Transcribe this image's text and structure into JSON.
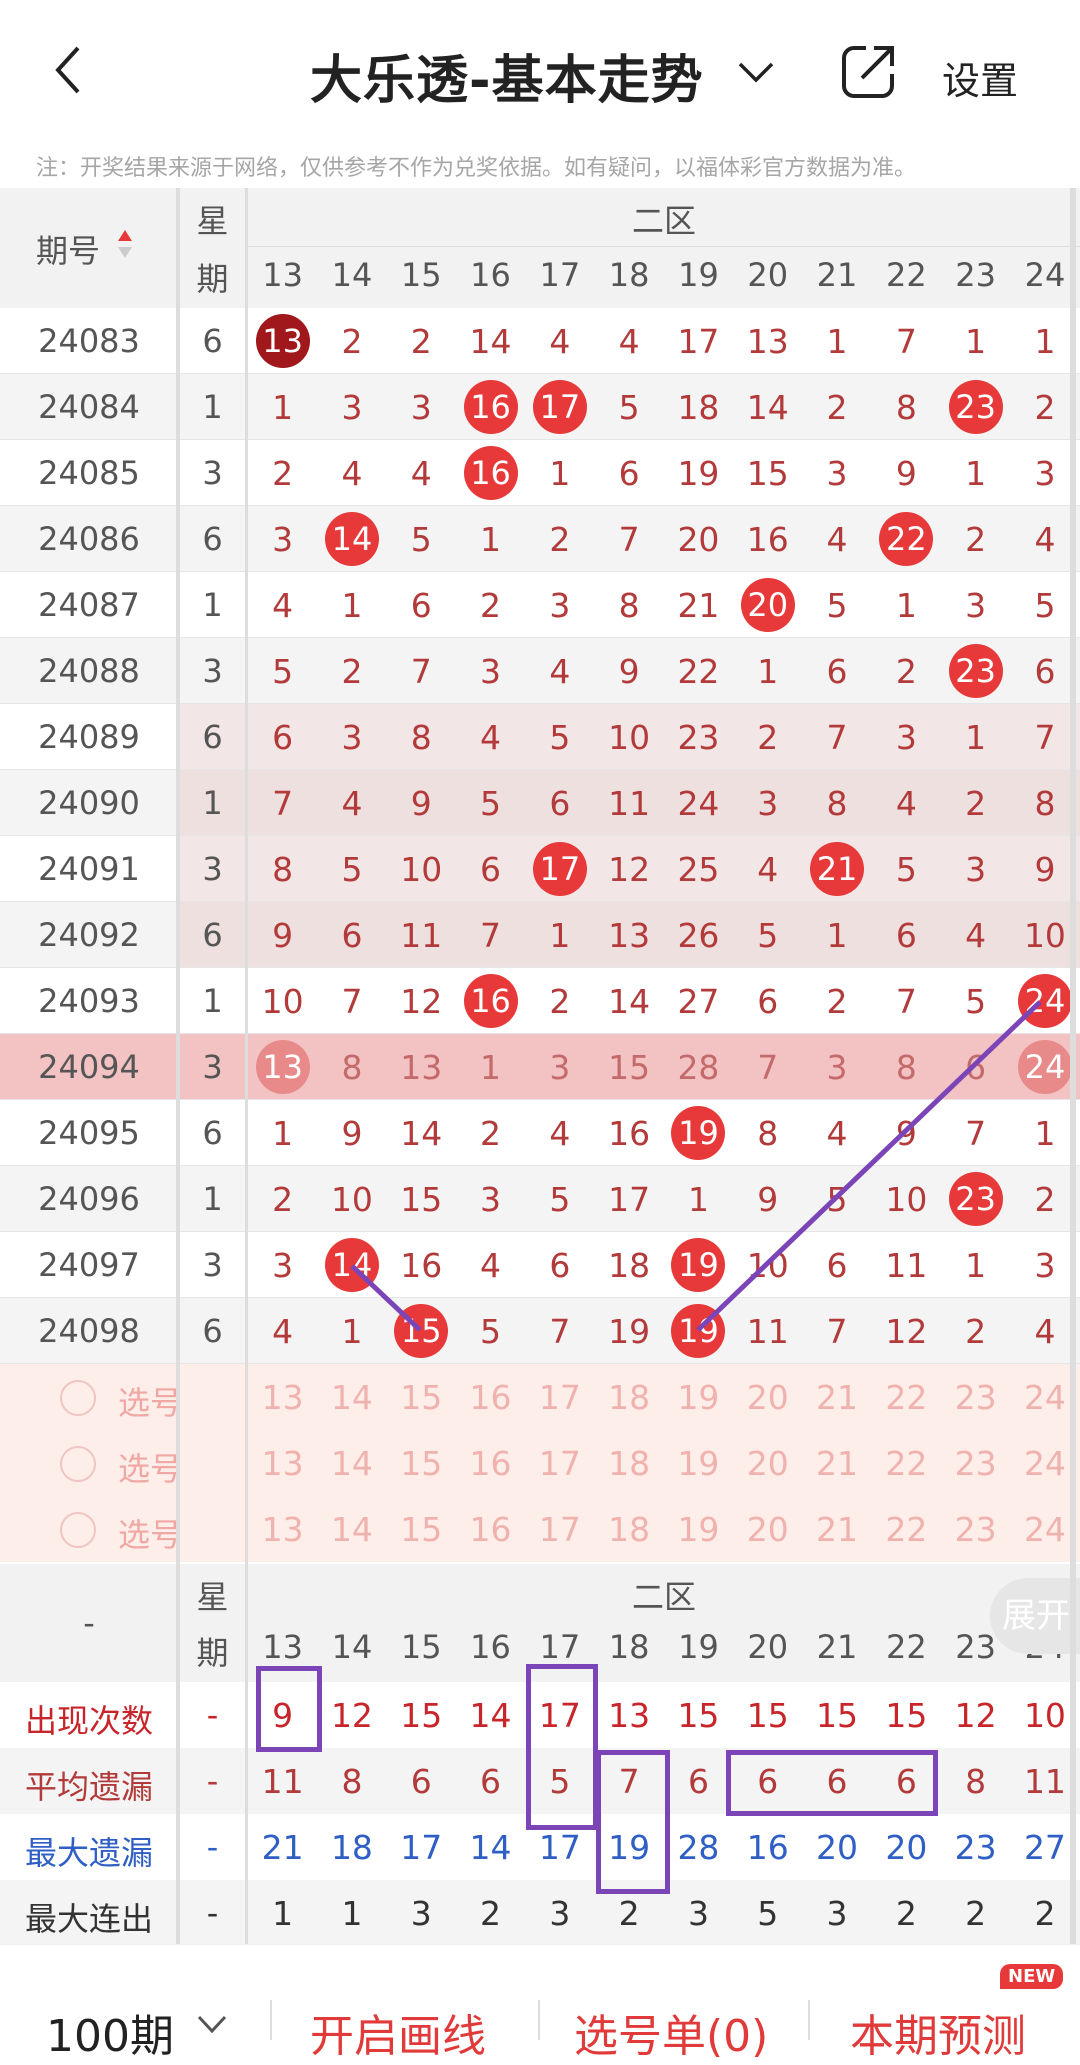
{
  "header": {
    "title": "大乐透-基本走势",
    "settings_label": "设置",
    "note": "注：开奖结果来源于网络，仅供参考不作为兑奖依据。如有疑问，以福体彩官方数据为准。"
  },
  "table": {
    "issue_header": "期号",
    "week_header_1": "星",
    "week_header_2": "期",
    "zone_header": "二区",
    "columns": [
      "13",
      "14",
      "15",
      "16",
      "17",
      "18",
      "19",
      "20",
      "21",
      "22",
      "23",
      "24"
    ],
    "rows": [
      {
        "issue": "24083",
        "week": "6",
        "cells": [
          "13",
          "2",
          "2",
          "14",
          "4",
          "4",
          "17",
          "13",
          "1",
          "7",
          "1",
          "1"
        ]
      },
      {
        "issue": "24084",
        "week": "1",
        "cells": [
          "1",
          "3",
          "3",
          "16",
          "17",
          "5",
          "18",
          "14",
          "2",
          "8",
          "23",
          "2"
        ]
      },
      {
        "issue": "24085",
        "week": "3",
        "cells": [
          "2",
          "4",
          "4",
          "16",
          "1",
          "6",
          "19",
          "15",
          "3",
          "9",
          "1",
          "3"
        ]
      },
      {
        "issue": "24086",
        "week": "6",
        "cells": [
          "3",
          "14",
          "5",
          "1",
          "2",
          "7",
          "20",
          "16",
          "4",
          "22",
          "2",
          "4"
        ]
      },
      {
        "issue": "24087",
        "week": "1",
        "cells": [
          "4",
          "1",
          "6",
          "2",
          "3",
          "8",
          "21",
          "20",
          "5",
          "1",
          "3",
          "5"
        ]
      },
      {
        "issue": "24088",
        "week": "3",
        "cells": [
          "5",
          "2",
          "7",
          "3",
          "4",
          "9",
          "22",
          "1",
          "6",
          "2",
          "23",
          "6"
        ]
      },
      {
        "issue": "24089",
        "week": "6",
        "cells": [
          "6",
          "3",
          "8",
          "4",
          "5",
          "10",
          "23",
          "2",
          "7",
          "3",
          "1",
          "7"
        ]
      },
      {
        "issue": "24090",
        "week": "1",
        "cells": [
          "7",
          "4",
          "9",
          "5",
          "6",
          "11",
          "24",
          "3",
          "8",
          "4",
          "2",
          "8"
        ]
      },
      {
        "issue": "24091",
        "week": "3",
        "cells": [
          "8",
          "5",
          "10",
          "6",
          "17",
          "12",
          "25",
          "4",
          "21",
          "5",
          "3",
          "9"
        ]
      },
      {
        "issue": "24092",
        "week": "6",
        "cells": [
          "9",
          "6",
          "11",
          "7",
          "1",
          "13",
          "26",
          "5",
          "1",
          "6",
          "4",
          "10"
        ]
      },
      {
        "issue": "24093",
        "week": "1",
        "cells": [
          "10",
          "7",
          "12",
          "16",
          "2",
          "14",
          "27",
          "6",
          "2",
          "7",
          "5",
          "24"
        ]
      },
      {
        "issue": "24094",
        "week": "3",
        "cells": [
          "13",
          "8",
          "13",
          "1",
          "3",
          "15",
          "28",
          "7",
          "3",
          "8",
          "6",
          "24"
        ]
      },
      {
        "issue": "24095",
        "week": "6",
        "cells": [
          "1",
          "9",
          "14",
          "2",
          "4",
          "16",
          "19",
          "8",
          "4",
          "9",
          "7",
          "1"
        ]
      },
      {
        "issue": "24096",
        "week": "1",
        "cells": [
          "2",
          "10",
          "15",
          "3",
          "5",
          "17",
          "1",
          "9",
          "5",
          "10",
          "23",
          "2"
        ]
      },
      {
        "issue": "24097",
        "week": "3",
        "cells": [
          "3",
          "14",
          "16",
          "4",
          "6",
          "18",
          "19",
          "10",
          "6",
          "11",
          "1",
          "3"
        ]
      },
      {
        "issue": "24098",
        "week": "6",
        "cells": [
          "4",
          "1",
          "15",
          "5",
          "7",
          "19",
          "19",
          "11",
          "7",
          "12",
          "2",
          "4"
        ]
      }
    ],
    "pick_label": "选号",
    "pick_rows": 3,
    "stats_dash": "-",
    "stats": [
      {
        "label": "出现次数",
        "color": "#c8252b",
        "values": [
          "9",
          "12",
          "15",
          "14",
          "17",
          "13",
          "15",
          "15",
          "15",
          "15",
          "12",
          "10"
        ]
      },
      {
        "label": "平均遗漏",
        "color": "#b23a3a",
        "values": [
          "11",
          "8",
          "6",
          "6",
          "5",
          "7",
          "6",
          "6",
          "6",
          "6",
          "8",
          "11"
        ]
      },
      {
        "label": "最大遗漏",
        "color": "#2f5fc4",
        "values": [
          "21",
          "18",
          "17",
          "14",
          "17",
          "19",
          "28",
          "16",
          "20",
          "20",
          "23",
          "27"
        ]
      },
      {
        "label": "最大连出",
        "color": "#333333",
        "values": [
          "1",
          "1",
          "3",
          "2",
          "3",
          "2",
          "3",
          "5",
          "3",
          "2",
          "2",
          "2"
        ]
      }
    ],
    "expand_label": "展开"
  },
  "footer": {
    "period": "100期",
    "draw_lines": "开启画线",
    "pick_list": "选号单(0)",
    "predict": "本期预测",
    "new_badge": "NEW"
  },
  "colors": {
    "ball": "#e8393a",
    "ball_dark": "#a0181c",
    "purple": "#7b45b8"
  }
}
